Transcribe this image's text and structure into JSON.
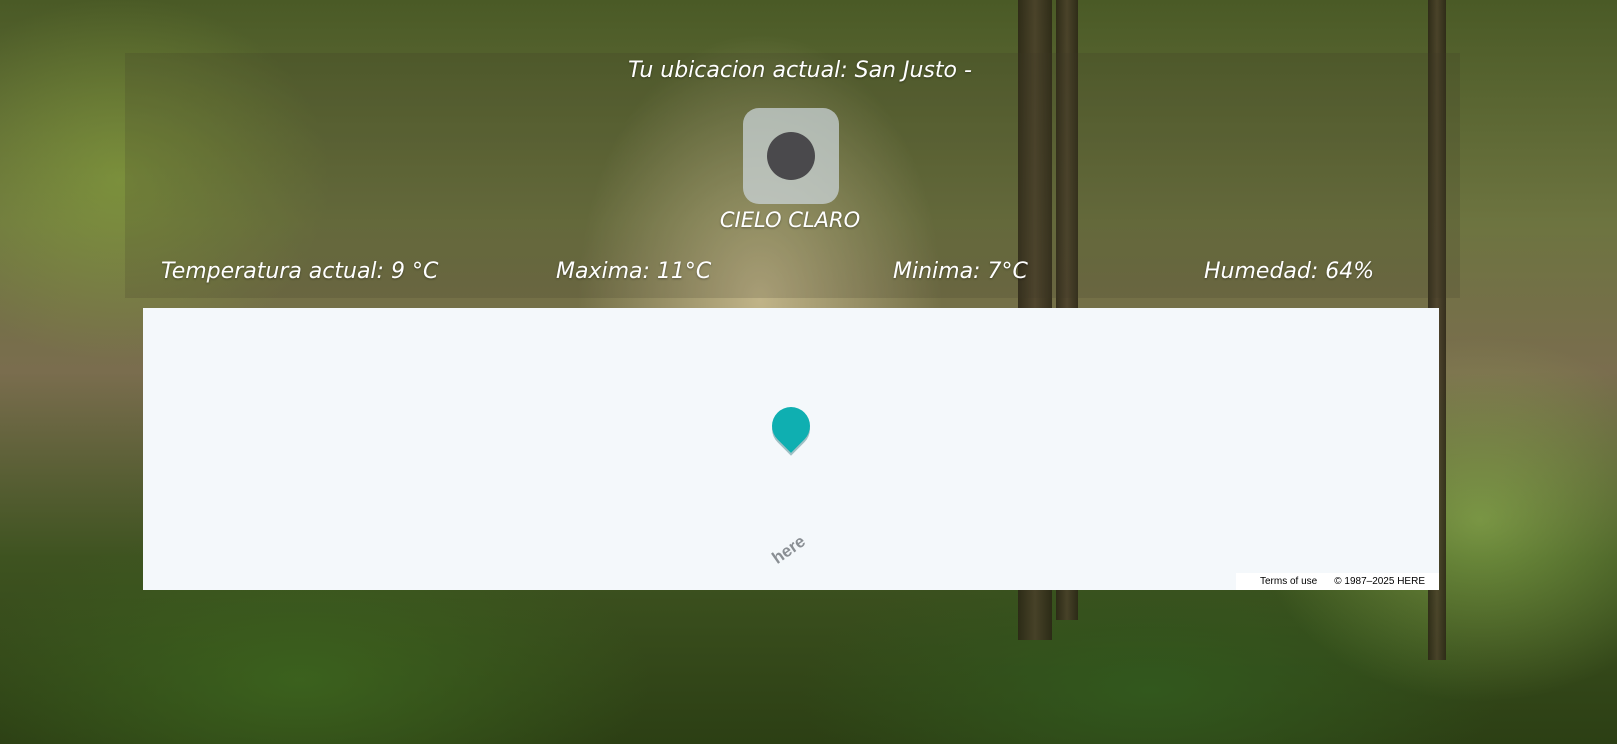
{
  "header": {
    "location_text": "Tu ubicacion actual: San Justo -"
  },
  "weather": {
    "icon": "weather-icon",
    "condition": "CIELO CLARO",
    "temperature": "Temperatura actual: 9 °C",
    "max": "Maxima: 11°C",
    "min": "Minima: 7°C",
    "humidity": "Humedad: 64%"
  },
  "map": {
    "marker_icon": "map-pin-icon",
    "logo_text": "here",
    "terms_label": "Terms of use",
    "copyright": "© 1987–2025 HERE"
  },
  "colors": {
    "marker": "#0fafb1",
    "map_background": "#f4f8fb",
    "text": "#ffffff"
  }
}
